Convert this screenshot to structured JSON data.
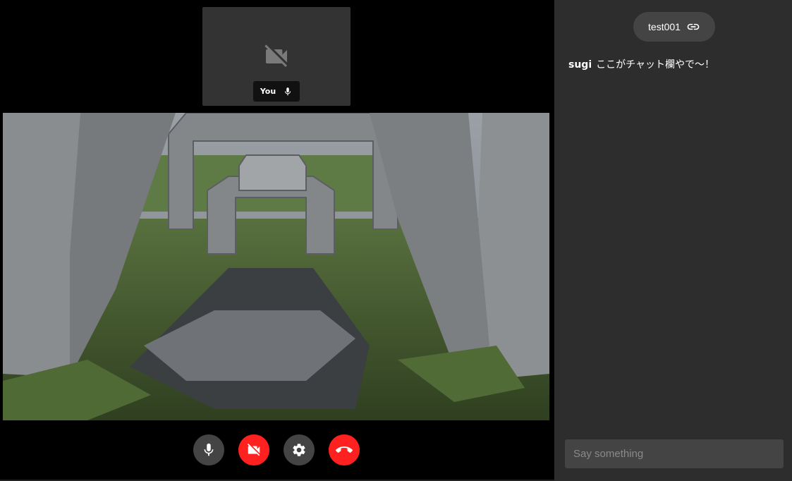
{
  "self_view": {
    "name": "You",
    "camera_state": "camera-off"
  },
  "controls": [
    {
      "name": "mic-toggle",
      "icon": "mic-icon",
      "color": "#444444"
    },
    {
      "name": "camera-toggle",
      "icon": "videocam-off-icon",
      "color": "#ff2020"
    },
    {
      "name": "settings",
      "icon": "gear-icon",
      "color": "#444444"
    },
    {
      "name": "hang-up",
      "icon": "phone-hangup-icon",
      "color": "#ff2020"
    }
  ],
  "sidebar": {
    "room_name": "test001",
    "room_icon": "link-icon",
    "messages": [
      {
        "author": "sugi",
        "text": "ここがチャット欄やで〜！"
      }
    ],
    "input_placeholder": "Say something"
  },
  "colors": {
    "accent_red": "#ff2020",
    "panel": "#2d2d2d",
    "button_grey": "#444444"
  }
}
